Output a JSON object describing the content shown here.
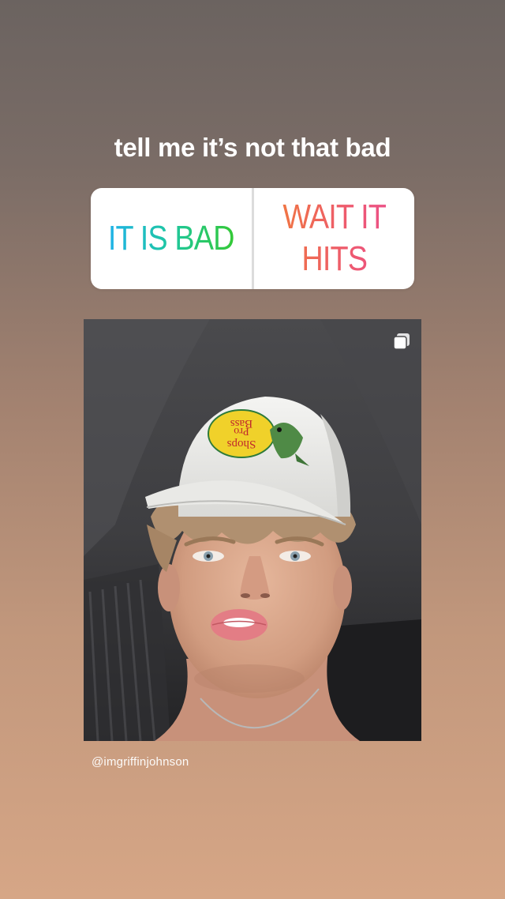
{
  "story": {
    "question": "tell me it’s not that bad",
    "poll": {
      "option_a": "IT IS BAD",
      "option_b": "WAIT IT HITS"
    },
    "shared_post": {
      "username": "@imgriffinjohnson",
      "multi_photo_icon": "carousel-icon",
      "hat_logo_lines": [
        "Bass",
        "Pro",
        "Shops"
      ]
    }
  },
  "colors": {
    "option_a_gradient": [
      "#1fb2e8",
      "#34c935"
    ],
    "option_b_gradient": [
      "#f07a3c",
      "#ea4e8e"
    ]
  }
}
